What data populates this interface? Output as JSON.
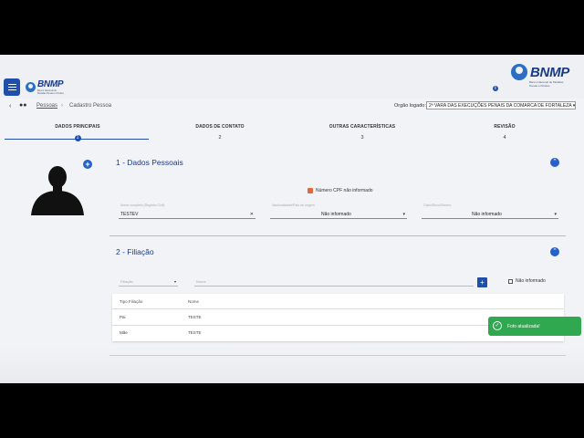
{
  "header": {
    "logo_small_text": "BNMP",
    "logo_small_sub": "Banco Nacional de Medidas Penais e Prisões",
    "logo_big_text": "BNMP",
    "logo_big_sub": "Banco Nacional de Medidas Penais e Prisões",
    "info_icon": "info-icon",
    "menu_icon": "hamburger-icon"
  },
  "breadcrumb": {
    "back": "‹",
    "people_icon": "people-icon",
    "pessoas": "Pessoas",
    "separator": "›",
    "current": "Cadastro Pessoa",
    "orgao_label": "Orgão logado:",
    "orgao_value": "2ª VARA DAS EXECUÇÕES PENAIS DA COMARCA DE FORTALEZA ▾"
  },
  "stepper": {
    "steps": [
      {
        "label": "DADOS PRINCIPAIS",
        "num": "1"
      },
      {
        "label": "DADOS DE CONTATO",
        "num": "2"
      },
      {
        "label": "OUTRAS CARACTERÍSTICAS",
        "num": "3"
      },
      {
        "label": "REVISÃO",
        "num": "4"
      }
    ]
  },
  "photo": {
    "add_label": "+"
  },
  "section1": {
    "title": "1 - Dados Pessoais",
    "collapse": "^",
    "cpf_label": "Número CPF não informado",
    "fields": [
      {
        "placeholder": "Nome completo (Registro Civil)",
        "value": "TESTEV",
        "ctrl": "✕"
      },
      {
        "placeholder": "Nacionalidade/País de origem",
        "value": "Não informado",
        "ctrl": "▾"
      },
      {
        "placeholder": "Outro/Sexo/Gênero",
        "value": "Não informado",
        "ctrl": "▾"
      }
    ]
  },
  "section2": {
    "title": "2 - Filiação",
    "collapse": "^",
    "filiacao_placeholder": "Filiação",
    "filiacao_ctrl": "▾",
    "nome_placeholder": "Nome",
    "add_label": "+",
    "nao_informado": "Não informado",
    "table": {
      "headers": [
        "Tipo Filiação",
        "Nome"
      ],
      "rows": [
        {
          "tipo": "Pai",
          "nome": "TESTE"
        },
        {
          "tipo": "Mãe",
          "nome": "TESTE"
        }
      ]
    }
  },
  "toast": {
    "message": "Foto atualizada!",
    "icon": "check-circle-icon"
  }
}
